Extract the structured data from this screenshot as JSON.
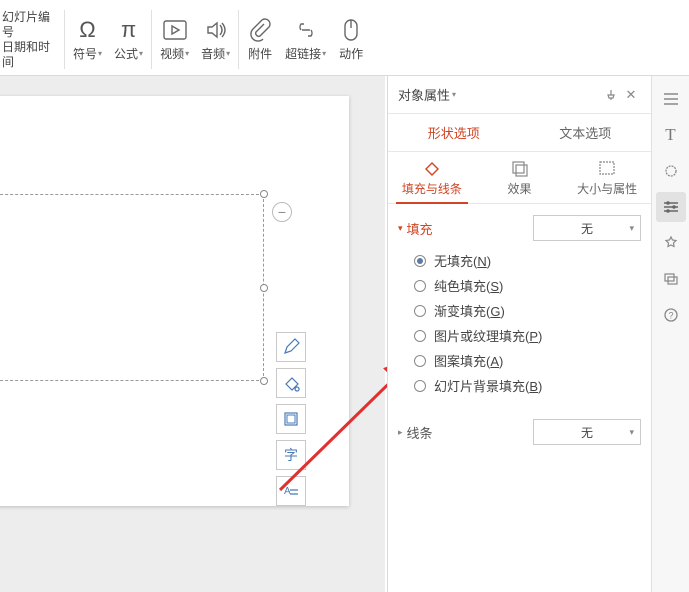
{
  "ribbon": {
    "left_items": [
      "幻灯片编号",
      "日期和时间"
    ],
    "items": [
      {
        "label": "符号",
        "dropdown": true,
        "glyph": "Ω"
      },
      {
        "label": "公式",
        "dropdown": true,
        "glyph": "π"
      },
      {
        "label": "视频",
        "dropdown": true
      },
      {
        "label": "音频",
        "dropdown": true
      },
      {
        "label": "附件",
        "dropdown": false
      },
      {
        "label": "超链接",
        "dropdown": true
      },
      {
        "label": "动作",
        "dropdown": false
      }
    ]
  },
  "panel": {
    "title": "对象属性",
    "tabs": {
      "shape": "形状选项",
      "text": "文本选项"
    },
    "subtabs": {
      "fill": "填充与线条",
      "effects": "效果",
      "size": "大小与属性"
    },
    "fill": {
      "title": "填充",
      "select": "无",
      "options": [
        {
          "label": "无填充(",
          "key": "N",
          "checked": true
        },
        {
          "label": "纯色填充(",
          "key": "S",
          "checked": false
        },
        {
          "label": "渐变填充(",
          "key": "G",
          "checked": false
        },
        {
          "label": "图片或纹理填充(",
          "key": "P",
          "checked": false
        },
        {
          "label": "图案填充(",
          "key": "A",
          "checked": false
        },
        {
          "label": "幻灯片背景填充(",
          "key": "B",
          "checked": false
        }
      ]
    },
    "line": {
      "title": "线条",
      "select": "无"
    }
  }
}
